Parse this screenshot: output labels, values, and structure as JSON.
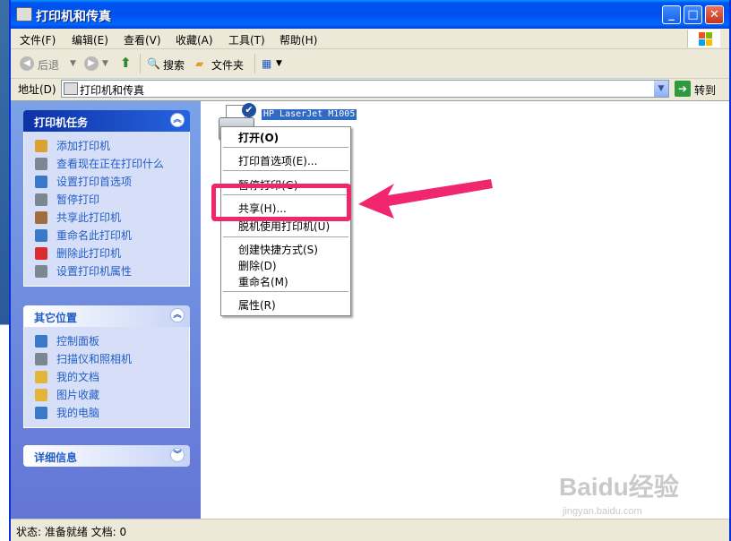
{
  "window": {
    "title": "打印机和传真",
    "controls": {
      "minimize": "_",
      "maximize": "□",
      "close": "✕"
    }
  },
  "menubar": {
    "items": [
      "文件(F)",
      "编辑(E)",
      "查看(V)",
      "收藏(A)",
      "工具(T)",
      "帮助(H)"
    ]
  },
  "toolbar": {
    "back_label": "后退",
    "search_label": "搜索",
    "folders_label": "文件夹"
  },
  "addressbar": {
    "label": "地址(D)",
    "value": "打印机和传真",
    "goto_label": "转到"
  },
  "taskpane": {
    "printer_tasks": {
      "title": "打印机任务",
      "items": [
        {
          "label": "添加打印机",
          "color": "#d9a233"
        },
        {
          "label": "查看现在正在打印什么",
          "color": "#7b8791"
        },
        {
          "label": "设置打印首选项",
          "color": "#3a78c8"
        },
        {
          "label": "暂停打印",
          "color": "#7b8791"
        },
        {
          "label": "共享此打印机",
          "color": "#a06d3e"
        },
        {
          "label": "重命名此打印机",
          "color": "#3a78c8"
        },
        {
          "label": "删除此打印机",
          "color": "#d92c2c"
        },
        {
          "label": "设置打印机属性",
          "color": "#7b8791"
        }
      ]
    },
    "other_places": {
      "title": "其它位置",
      "items": [
        {
          "label": "控制面板",
          "color": "#3a78c8"
        },
        {
          "label": "扫描仪和照相机",
          "color": "#7b8791"
        },
        {
          "label": "我的文档",
          "color": "#e2b53a"
        },
        {
          "label": "图片收藏",
          "color": "#e2b53a"
        },
        {
          "label": "我的电脑",
          "color": "#3a78c8"
        }
      ]
    },
    "details": {
      "title": "详细信息"
    }
  },
  "printer": {
    "label": "HP LaserJet M1005"
  },
  "context_menu": {
    "items": [
      {
        "label": "打开(O)",
        "bold": true
      },
      {
        "label": "打印首选项(E)..."
      },
      {
        "label": "暂停打印(G)"
      },
      {
        "label": "共享(H)..."
      },
      {
        "label": "脱机使用打印机(U)"
      },
      {
        "label": "创建快捷方式(S)"
      },
      {
        "label": "删除(D)"
      },
      {
        "label": "重命名(M)"
      },
      {
        "label": "属性(R)"
      }
    ]
  },
  "statusbar": {
    "text": "状态: 准备就绪 文档: 0"
  },
  "watermark": {
    "text": "Baidu经验",
    "sub": "jingyan.baidu.com"
  },
  "colors": {
    "titlebar": "#0053ee",
    "taskpane": "#7ba2e7",
    "highlight": "#f0266f",
    "selection": "#316ac5"
  }
}
